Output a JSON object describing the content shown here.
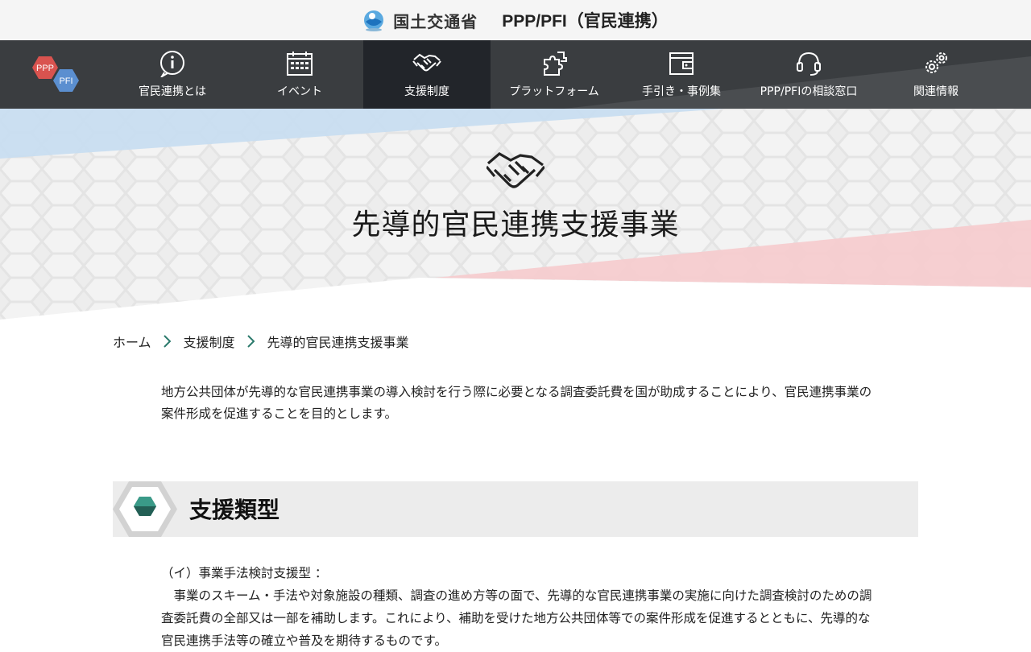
{
  "header": {
    "ministry_name": "国土交通省",
    "site_title": "PPP/PFI（官民連携）"
  },
  "nav": {
    "logo_top": "PPP",
    "logo_bottom": "PFI",
    "items": [
      {
        "label": "官民連携とは",
        "icon": "info-icon"
      },
      {
        "label": "イベント",
        "icon": "calendar-icon"
      },
      {
        "label": "支援制度",
        "icon": "handshake-icon",
        "active": true
      },
      {
        "label": "プラットフォーム",
        "icon": "puzzle-icon"
      },
      {
        "label": "手引き・事例集",
        "icon": "wallet-icon"
      },
      {
        "label": "PPP/PFIの相談窓口",
        "icon": "headset-icon"
      },
      {
        "label": "関連情報",
        "icon": "gears-icon"
      }
    ]
  },
  "hero": {
    "title": "先導的官民連携支援事業"
  },
  "breadcrumb": {
    "items": [
      "ホーム",
      "支援制度",
      "先導的官民連携支援事業"
    ]
  },
  "intro": {
    "text": "地方公共団体が先導的な官民連携事業の導入検討を行う際に必要となる調査委託費を国が助成することにより、官民連携事業の案件形成を促進することを目的とします。"
  },
  "section": {
    "title": "支援類型",
    "type_heading": "（イ）事業手法検討支援型 ：",
    "type_body": "事業のスキーム・手法や対象施設の種類、調査の進め方等の面で、先導的な官民連携事業の実施に向けた調査検討のための調査委託費の全部又は一部を補助します。これにより、補助を受けた地方公共団体等での案件形成を促進するとともに、先導的な官民連携手法等の確立や普及を期待するものです。"
  },
  "colors": {
    "nav_bg": "#3a3d40",
    "nav_active": "#22252a",
    "accent_teal": "#2b7a6c",
    "hero_blue": "#c6ddf1",
    "hero_pink": "#f6cccf"
  }
}
